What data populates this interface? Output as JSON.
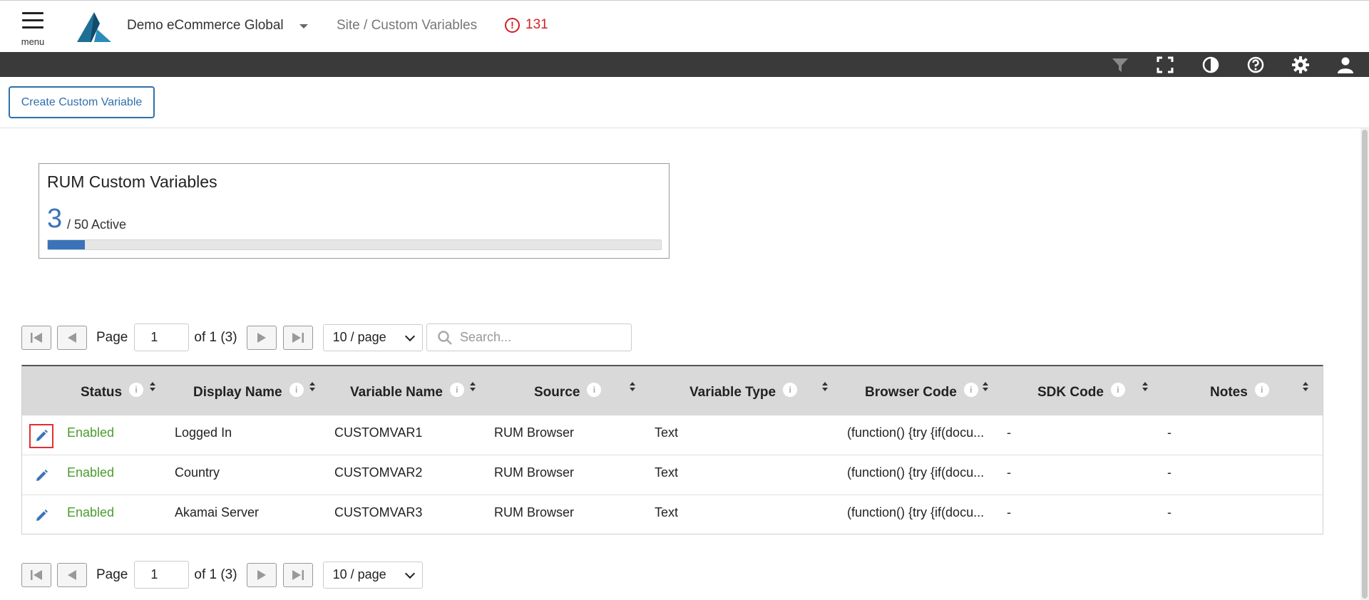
{
  "header": {
    "menu_label": "menu",
    "site_name": "Demo eCommerce Global",
    "breadcrumb": "Site / Custom Variables",
    "alert_count": "131",
    "icons": [
      "filter-icon",
      "fullscreen-icon",
      "contrast-icon",
      "help-icon",
      "settings-icon",
      "user-icon"
    ]
  },
  "toolbar": {
    "create_label": "Create Custom Variable"
  },
  "card": {
    "title": "RUM Custom Variables",
    "active_count": "3",
    "active_suffix": "/ 50 Active",
    "usage_fraction": 0.06
  },
  "pager": {
    "page_label": "Page",
    "page_value": "1",
    "of_label": "of 1 (3)",
    "per_page": "10 / page",
    "search_placeholder": "Search..."
  },
  "table": {
    "columns": [
      "Status",
      "Display Name",
      "Variable Name",
      "Source",
      "Variable Type",
      "Browser Code",
      "SDK Code",
      "Notes"
    ],
    "rows": [
      {
        "status": "Enabled",
        "display": "Logged In",
        "variable": "CUSTOMVAR1",
        "source": "RUM Browser",
        "type": "Text",
        "browser": "(function() {try {if(docu...",
        "sdk": "-",
        "notes": "-"
      },
      {
        "status": "Enabled",
        "display": "Country",
        "variable": "CUSTOMVAR2",
        "source": "RUM Browser",
        "type": "Text",
        "browser": "(function() {try {if(docu...",
        "sdk": "-",
        "notes": "-"
      },
      {
        "status": "Enabled",
        "display": "Akamai Server",
        "variable": "CUSTOMVAR3",
        "source": "RUM Browser",
        "type": "Text",
        "browser": "(function() {try {if(docu...",
        "sdk": "-",
        "notes": "-"
      }
    ]
  },
  "colors": {
    "accent": "#3a73b9",
    "enabled": "#4a9c2d",
    "alert": "#d21f26",
    "darkbar": "#3a3a3a"
  }
}
